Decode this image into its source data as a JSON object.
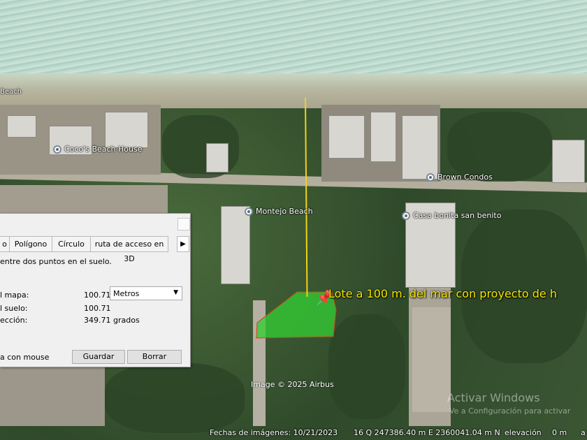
{
  "map": {
    "places": [
      {
        "id": "cocos",
        "label": "Coco's Beach House"
      },
      {
        "id": "brown",
        "label": "Brown Condos"
      },
      {
        "id": "montejo",
        "label": "Montejo Beach"
      },
      {
        "id": "casa",
        "label": "Casa bonita san benito"
      }
    ],
    "beach_label": "Beach",
    "placemark_label": "Lote a 100 m. del mar con proyecto de h",
    "attribution": "Image © 2025 Airbus",
    "watermark_title": "Activar Windows",
    "watermark_subtitle": "Ve a Configuración para activar"
  },
  "status": {
    "imagery_date": "Fechas de imágenes: 10/21/2023",
    "coordinates": "16 Q 247386.40 m E 2360041.04 m N",
    "elevation": "elevación",
    "elevation_value": "0 m",
    "trailing": "a"
  },
  "ruler": {
    "tabs": [
      "o",
      "Polígono",
      "Círculo",
      "ruta de acceso en 3D"
    ],
    "description": "entre dos puntos en el suelo.",
    "map_length_label": "l mapa:",
    "map_length_value": "100.71",
    "units_selected": "Metros",
    "ground_length_label": "l suelo:",
    "ground_length_value": "100.71",
    "heading_label": "ección:",
    "heading_value": "349.71 grados",
    "mouse_label": "a con mouse",
    "save_button": "Guardar",
    "clear_button": "Borrar"
  }
}
